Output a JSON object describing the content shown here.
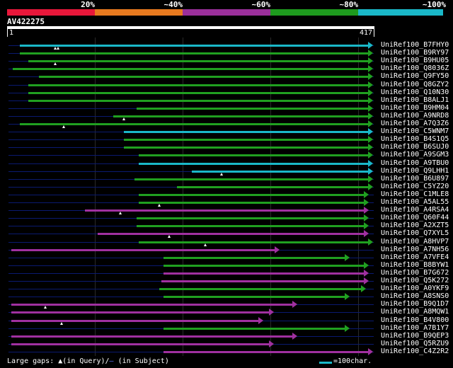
{
  "query": {
    "name": "AV422275",
    "start": "1",
    "end": "417"
  },
  "legend": {
    "bands": [
      {
        "label": "20%",
        "color": "#e8173a"
      },
      {
        "label": "~40%",
        "color": "#e87a1f"
      },
      {
        "label": "~60%",
        "color": "#9a2f9a"
      },
      {
        "label": "~80%",
        "color": "#1e9a1e"
      },
      {
        "label": "~100%",
        "color": "#1ab8c8"
      }
    ]
  },
  "colors": {
    "cyan": "#1ab8c8",
    "green": "#20a020",
    "purple": "#a030a0",
    "track": "#0a1a70"
  },
  "hits": [
    {
      "name": "UniRef100_B7FHY0",
      "color": "cyan",
      "start": 28,
      "end": 520,
      "gaps": [
        78,
        82
      ]
    },
    {
      "name": "UniRef100_B9RY97",
      "color": "green",
      "start": 28,
      "end": 520,
      "gaps": []
    },
    {
      "name": "UniRef100_B9HU05",
      "color": "green",
      "start": 40,
      "end": 520,
      "gaps": [
        78
      ]
    },
    {
      "name": "UniRef100_Q8036Z",
      "color": "green",
      "start": 18,
      "end": 520,
      "gaps": []
    },
    {
      "name": "UniRef100_Q9FY50",
      "color": "green",
      "start": 55,
      "end": 520,
      "gaps": []
    },
    {
      "name": "UniRef100_Q8GZY2",
      "color": "green",
      "start": 40,
      "end": 520,
      "gaps": []
    },
    {
      "name": "UniRef100_Q10N30",
      "color": "green",
      "start": 40,
      "end": 520,
      "gaps": []
    },
    {
      "name": "UniRef100_B8ALJ1",
      "color": "green",
      "start": 40,
      "end": 520,
      "gaps": []
    },
    {
      "name": "UniRef100_B9HM04",
      "color": "green",
      "start": 193,
      "end": 520,
      "gaps": []
    },
    {
      "name": "UniRef100_A9NRD8",
      "color": "green",
      "start": 160,
      "end": 520,
      "gaps": [
        175
      ]
    },
    {
      "name": "UniRef100_A7Q3Z6",
      "color": "green",
      "start": 28,
      "end": 520,
      "gaps": [
        90
      ]
    },
    {
      "name": "UniRef100_C5WNM7",
      "color": "cyan",
      "start": 175,
      "end": 520,
      "gaps": []
    },
    {
      "name": "UniRef100_B4S1Q5",
      "color": "green",
      "start": 175,
      "end": 520,
      "gaps": []
    },
    {
      "name": "UniRef100_B6SUJ0",
      "color": "green",
      "start": 175,
      "end": 520,
      "gaps": []
    },
    {
      "name": "UniRef100_A9SGM3",
      "color": "green",
      "start": 196,
      "end": 520,
      "gaps": []
    },
    {
      "name": "UniRef100_A9TBU0",
      "color": "cyan",
      "start": 196,
      "end": 520,
      "gaps": []
    },
    {
      "name": "UniRef100_Q9LHH1",
      "color": "cyan",
      "start": 271,
      "end": 520,
      "gaps": [
        313
      ]
    },
    {
      "name": "UniRef100_B6U897",
      "color": "green",
      "start": 190,
      "end": 520,
      "gaps": []
    },
    {
      "name": "UniRef100_C5YZ20",
      "color": "green",
      "start": 250,
      "end": 520,
      "gaps": []
    },
    {
      "name": "UniRef100_C1MLE8",
      "color": "green",
      "start": 196,
      "end": 514,
      "gaps": []
    },
    {
      "name": "UniRef100_A5AL55",
      "color": "green",
      "start": 196,
      "end": 514,
      "gaps": [
        225
      ]
    },
    {
      "name": "UniRef100_A4RSA4",
      "color": "purple",
      "start": 120,
      "end": 514,
      "gaps": [
        170
      ]
    },
    {
      "name": "UniRef100_Q60F44",
      "color": "green",
      "start": 193,
      "end": 514,
      "gaps": []
    },
    {
      "name": "UniRef100_A2XZT5",
      "color": "green",
      "start": 193,
      "end": 514,
      "gaps": []
    },
    {
      "name": "UniRef100_Q7XYL5",
      "color": "purple",
      "start": 138,
      "end": 514,
      "gaps": [
        239
      ]
    },
    {
      "name": "UniRef100_A8HVP7",
      "color": "green",
      "start": 196,
      "end": 520,
      "gaps": [
        290
      ]
    },
    {
      "name": "UniRef100_A7NH56",
      "color": "purple",
      "start": 16,
      "end": 388,
      "gaps": []
    },
    {
      "name": "UniRef100_A7VFE4",
      "color": "green",
      "start": 231,
      "end": 487,
      "gaps": []
    },
    {
      "name": "UniRef100_B8BYW1",
      "color": "green",
      "start": 231,
      "end": 514,
      "gaps": []
    },
    {
      "name": "UniRef100_B7G672",
      "color": "purple",
      "start": 231,
      "end": 514,
      "gaps": []
    },
    {
      "name": "UniRef100_Q5K272",
      "color": "purple",
      "start": 228,
      "end": 514,
      "gaps": []
    },
    {
      "name": "UniRef100_A0YKF9",
      "color": "green",
      "start": 225,
      "end": 510,
      "gaps": []
    },
    {
      "name": "UniRef100_A8SNS0",
      "color": "green",
      "start": 231,
      "end": 487,
      "gaps": []
    },
    {
      "name": "UniRef100_B9Q1D7",
      "color": "purple",
      "start": 16,
      "end": 413,
      "gaps": [
        64
      ]
    },
    {
      "name": "UniRef100_A8MQW1",
      "color": "purple",
      "start": 16,
      "end": 380,
      "gaps": []
    },
    {
      "name": "UniRef100_B4V800",
      "color": "purple",
      "start": 16,
      "end": 365,
      "gaps": [
        87
      ]
    },
    {
      "name": "UniRef100_A7B1Y7",
      "color": "green",
      "start": 231,
      "end": 487,
      "gaps": []
    },
    {
      "name": "UniRef100_B9QEP3",
      "color": "purple",
      "start": 16,
      "end": 413,
      "gaps": []
    },
    {
      "name": "UniRef100_Q5RZU9",
      "color": "purple",
      "start": 16,
      "end": 380,
      "gaps": []
    },
    {
      "name": "UniRef100_C4Z2R2",
      "color": "purple",
      "start": 231,
      "end": 520,
      "gaps": []
    }
  ],
  "footer": {
    "large_gaps_label": "Large gaps:",
    "in_query": "(in Query)/",
    "in_subject": "(in Subject)",
    "scale_label": "=100char."
  }
}
